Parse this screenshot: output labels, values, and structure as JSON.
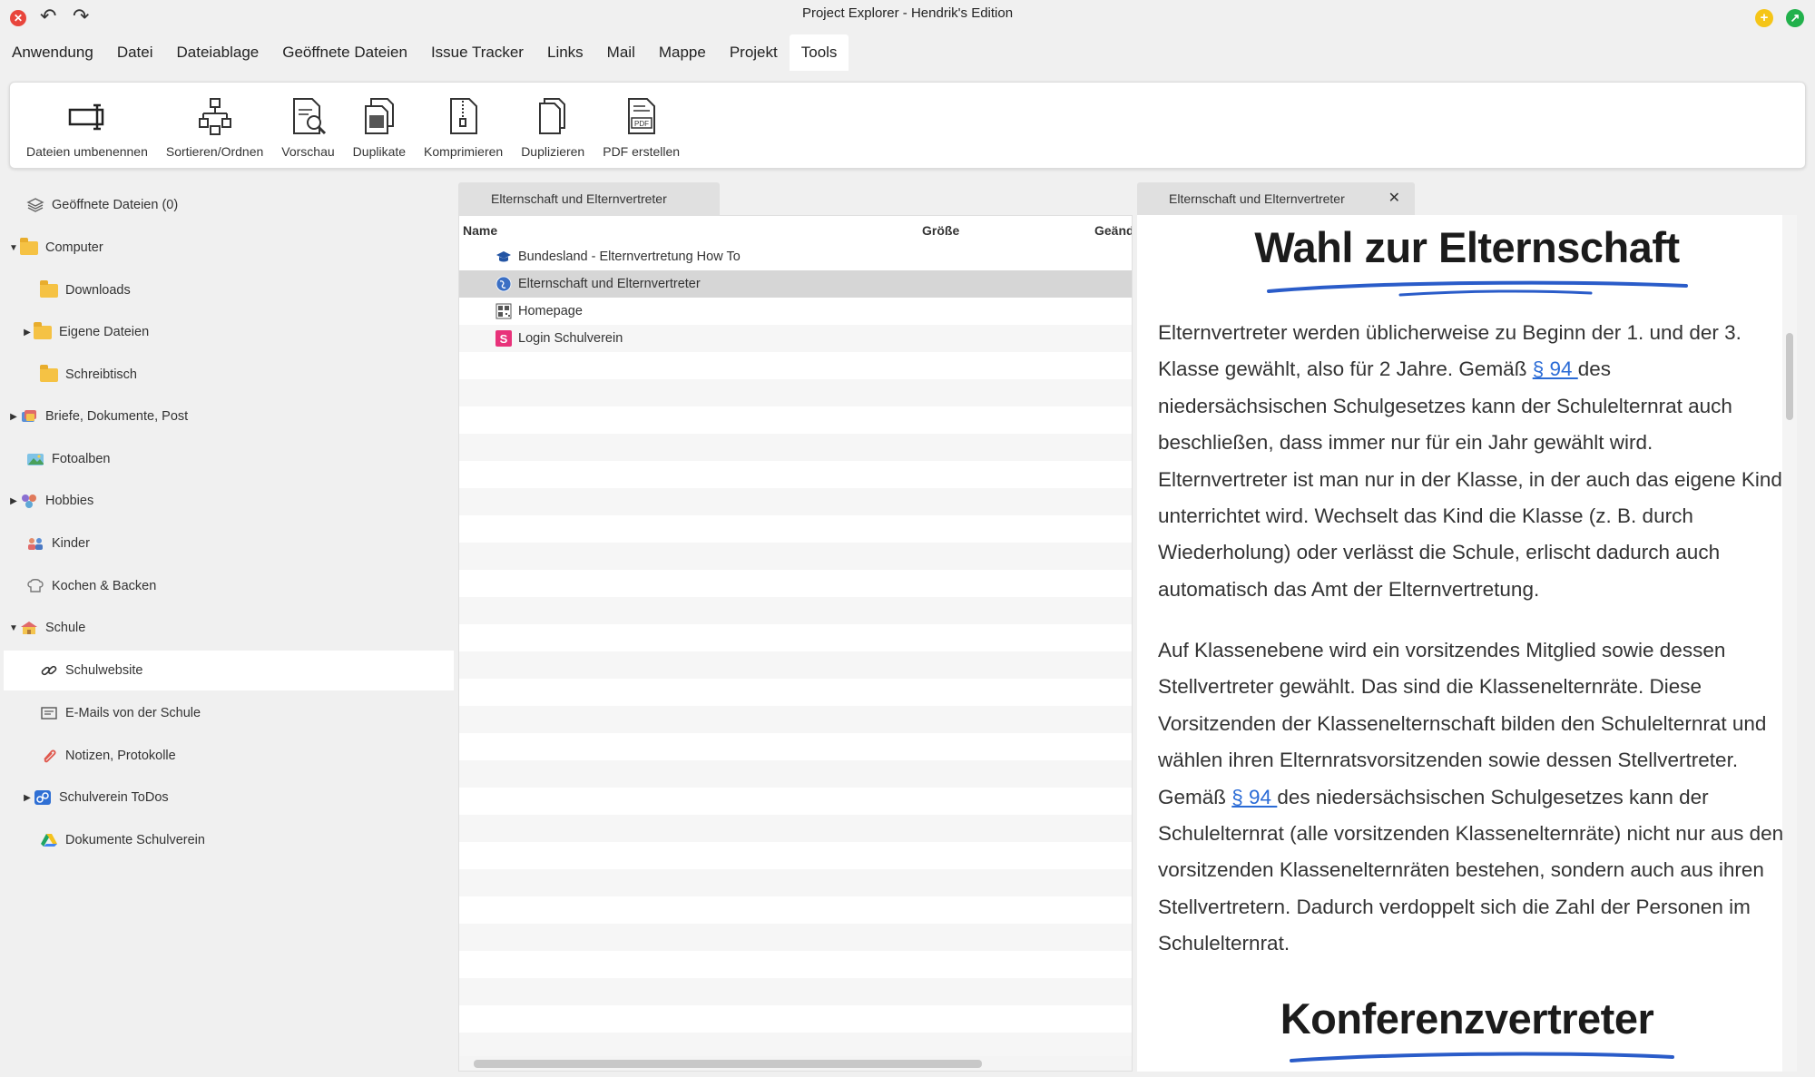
{
  "window": {
    "title": "Project Explorer - Hendrik's Edition",
    "close_glyph": "✕",
    "min_glyph": "+",
    "max_glyph": "↗",
    "undo_glyph": "↶",
    "redo_glyph": "↷"
  },
  "menu": [
    "Anwendung",
    "Datei",
    "Dateiablage",
    "Geöffnete Dateien",
    "Issue Tracker",
    "Links",
    "Mail",
    "Mappe",
    "Projekt",
    "Tools"
  ],
  "menu_active": "Tools",
  "ribbon": {
    "tools": [
      {
        "label": "Dateien umbenennen",
        "icon": "rename-icon"
      },
      {
        "label": "Sortieren/Ordnen",
        "icon": "hierarchy-icon"
      },
      {
        "label": "Vorschau",
        "icon": "preview-doc-icon"
      },
      {
        "label": "Duplikate",
        "icon": "duplicates-icon"
      },
      {
        "label": "Komprimieren",
        "icon": "zip-icon"
      },
      {
        "label": "Duplizieren",
        "icon": "copy-icon"
      },
      {
        "label": "PDF erstellen",
        "icon": "pdf-icon"
      }
    ]
  },
  "sidebar": {
    "items": [
      {
        "label": "Geöffnete Dateien (0)",
        "icon": "layers-icon",
        "arrow": ""
      },
      {
        "label": "Computer",
        "icon": "folder-icon",
        "arrow": "▼"
      },
      {
        "label": "Downloads",
        "icon": "folder-icon",
        "arrow": ""
      },
      {
        "label": "Eigene Dateien",
        "icon": "folder-icon",
        "arrow": "▶"
      },
      {
        "label": "Schreibtisch",
        "icon": "folder-icon",
        "arrow": ""
      },
      {
        "label": "Briefe, Dokumente, Post",
        "icon": "letters-icon",
        "arrow": "▶"
      },
      {
        "label": "Fotoalben",
        "icon": "photo-icon",
        "arrow": ""
      },
      {
        "label": "Hobbies",
        "icon": "hobbies-icon",
        "arrow": "▶"
      },
      {
        "label": "Kinder",
        "icon": "kids-icon",
        "arrow": ""
      },
      {
        "label": "Kochen & Backen",
        "icon": "chef-hat-icon",
        "arrow": ""
      },
      {
        "label": "Schule",
        "icon": "school-icon",
        "arrow": "▼"
      },
      {
        "label": "Schulwebsite",
        "icon": "link-icon",
        "arrow": ""
      },
      {
        "label": "E-Mails von der Schule",
        "icon": "mail-icon",
        "arrow": ""
      },
      {
        "label": "Notizen, Protokolle",
        "icon": "paperclip-icon",
        "arrow": ""
      },
      {
        "label": "Schulverein ToDos",
        "icon": "todo-icon",
        "arrow": "▶"
      },
      {
        "label": "Dokumente Schulverein",
        "icon": "drive-icon",
        "arrow": ""
      }
    ]
  },
  "filelist": {
    "tab": "Elternschaft und Elternvertreter",
    "columns": [
      "Name",
      "Größe",
      "Geänd"
    ],
    "rows": [
      {
        "name": "Bundesland - Elternvertretung How To",
        "icon": "graduation-icon"
      },
      {
        "name": "Elternschaft und Elternvertreter",
        "icon": "globe-icon"
      },
      {
        "name": "Homepage",
        "icon": "qr-icon"
      },
      {
        "name": "Login Schulverein",
        "icon": "s-logo-icon"
      }
    ]
  },
  "preview": {
    "tab": "Elternschaft und Elternvertreter",
    "tab_close": "✕",
    "heading1": "Wahl zur Elternschaft",
    "para1": {
      "t1": "Elternvertreter werden üblicherweise zu Beginn der 1. und der 3. Klasse gewählt, also für 2 Jahre. Gemäß ",
      "link": "§ 94 ",
      "t2": "des niedersächsischen Schulgesetzes kann der Schulelternrat auch beschließen, dass immer nur für ein Jahr gewählt wird. Elternvertreter ist man nur in der Klasse, in der auch das eigene Kind unterrichtet wird. Wechselt das Kind die Klasse (z. B. durch Wiederholung) oder verlässt die Schule, erlischt dadurch auch automatisch das Amt der Elternvertretung."
    },
    "para2": {
      "t1": "Auf Klassenebene wird ein vorsitzendes Mitglied sowie dessen Stellvertreter gewählt. Das sind die Klassenelternräte. Diese Vorsitzenden der Klassenelternschaft bilden den Schulelternrat und wählen ihren Elternratsvorsitzenden sowie dessen Stellvertreter. Gemäß ",
      "link": "§ 94 ",
      "t2": "des niedersächsischen Schulgesetzes kann der Schulelternrat (alle vorsitzenden Klassenelternräte) nicht nur aus den vorsitzenden Klassenelternräten bestehen, sondern auch aus ihren Stellvertretern. Dadurch verdoppelt sich die Zahl der Personen im Schulelternrat."
    },
    "heading2": "Konferenzvertreter"
  },
  "colors": {
    "accent_link": "#2a6bd6",
    "underline_stroke": "#2a5cc9",
    "folder": "#f5c244"
  }
}
